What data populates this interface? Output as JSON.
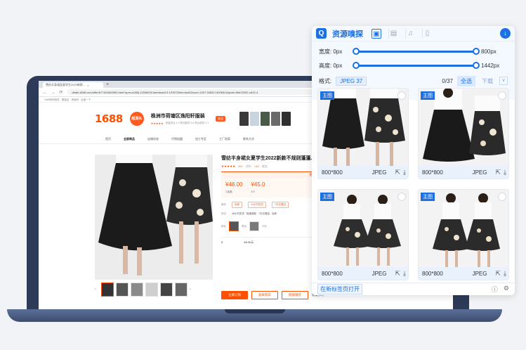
{
  "browser": {
    "tab_title": "雪纺半身裙女夏学生2022新款...",
    "url": "detail.1688.com/offer/677401852563.html?spm=a260j.12536015.ldmhbws3.5.1976700eirrxkmD&scm=1007.30832.181565.0&pvid=b5e22092-c613-4",
    "bookmarks": "1688采购批发 · 服装店 · 淘宝网 · 百度一下"
  },
  "shop": {
    "logo": "1688",
    "badge": "超源头",
    "name": "株洲市荷塘区逸阳轩服装",
    "stats": "质量综合 4.2   物流服务 5.6   售后服务 3.1",
    "follow": "关注",
    "nav": [
      "首页",
      "全部商品",
      "店铺动态",
      "代销加盟",
      "加工专区",
      "工厂档案",
      "联系方式"
    ]
  },
  "product": {
    "title": "雪纺半身裙女夏学生2022新款不规则蓬蓬...",
    "rating_count": "10+",
    "rating_text": "评价",
    "sales": "<10",
    "sales_text": "成交",
    "wholesale": "批发",
    "price1": "¥48.00",
    "price1_qty": "2 起批",
    "price2": "¥45.0",
    "price2_qty": "5-9",
    "service_label": "服务",
    "service_chips": [
      "包邮",
      "24小时发货",
      "7天无理由"
    ],
    "ship_label": "物流",
    "ship_value": "48小时发货 · 极速退款 · 7天无理由 · 包养",
    "color_label": "颜色",
    "color_options": [
      "黑色",
      "印花"
    ],
    "qty_label": "5",
    "qty_price": "48.00元",
    "buy_label": "立即订购",
    "cart_label": "加采购车",
    "cross_label": "跨境铺货",
    "fav_label": "收藏(15)"
  },
  "extension": {
    "title": "资源嗅探",
    "width_label": "宽度: 0px",
    "width_max": "800px",
    "height_label": "高度: 0px",
    "height_max": "1442px",
    "format_label": "格式:",
    "format_value": "JPEG 37",
    "count": "0/37",
    "select_all": "全选",
    "download": "下载",
    "dropdown": "∨",
    "open_new_tab": "在新标签页打开",
    "cards": [
      {
        "badge": "主图",
        "size": "800*800",
        "format": "JPEG"
      },
      {
        "badge": "主图",
        "size": "800*800",
        "format": "JPEG"
      },
      {
        "badge": "主图",
        "size": "800*800",
        "format": "JPEG"
      },
      {
        "badge": "主图",
        "size": "800*800",
        "format": "JPEG"
      }
    ],
    "accent": "#1e6fe0"
  }
}
